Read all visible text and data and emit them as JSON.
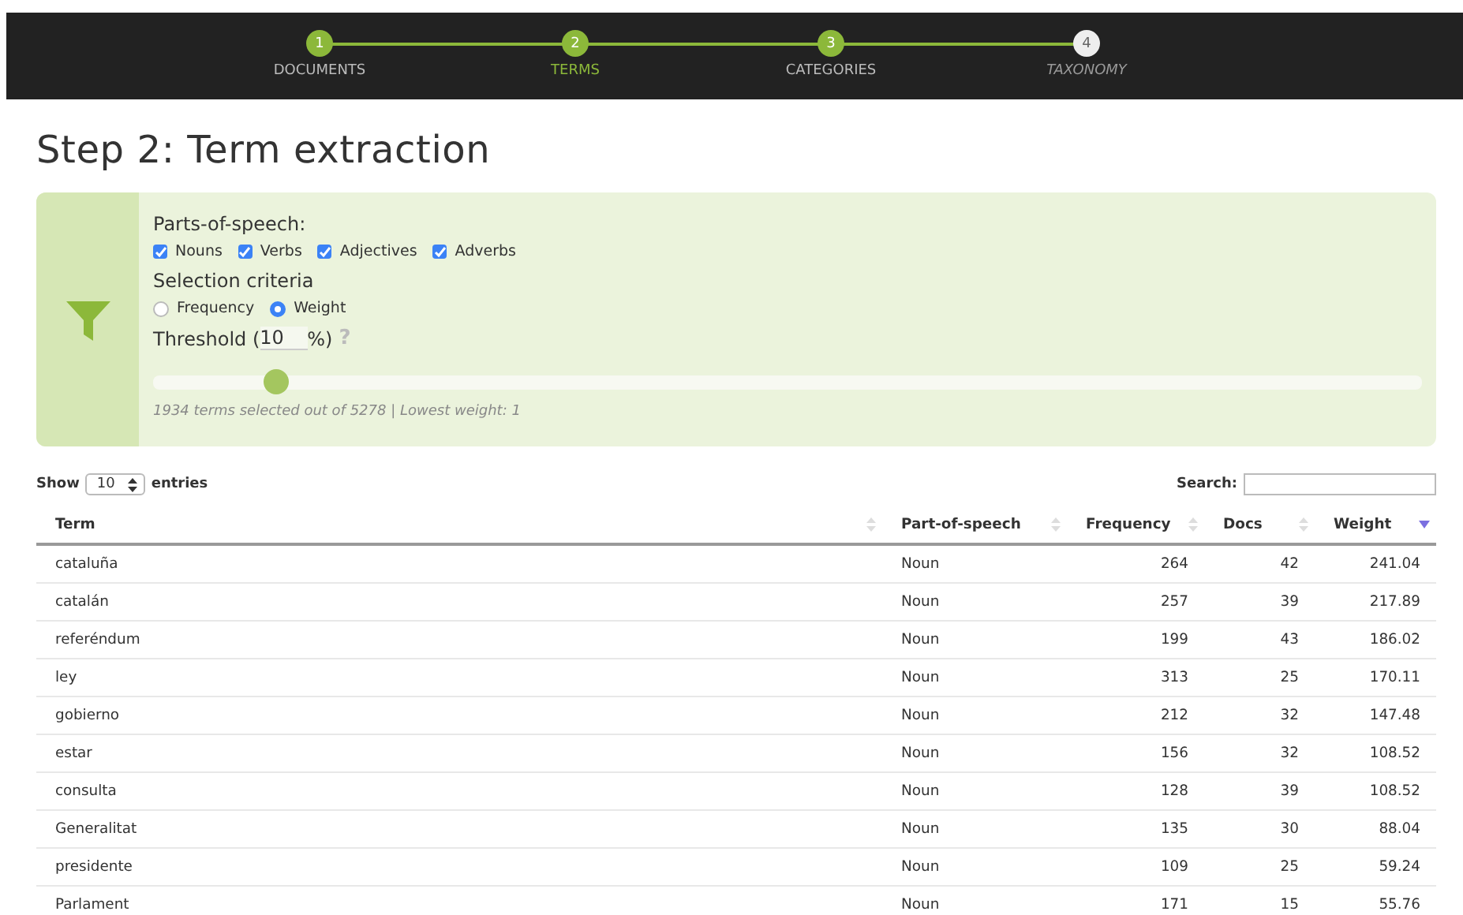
{
  "steps": [
    {
      "number": "1",
      "label": "DOCUMENTS",
      "reached": true,
      "selected": false
    },
    {
      "number": "2",
      "label": "TERMS",
      "reached": true,
      "selected": true
    },
    {
      "number": "3",
      "label": "CATEGORIES",
      "reached": true,
      "selected": false
    },
    {
      "number": "4",
      "label": "TAXONOMY",
      "reached": false,
      "selected": false
    }
  ],
  "title": "Step 2: Term extraction",
  "filter": {
    "pos_heading": "Parts-of-speech:",
    "pos": [
      {
        "label": "Nouns",
        "checked": true
      },
      {
        "label": "Verbs",
        "checked": true
      },
      {
        "label": "Adjectives",
        "checked": true
      },
      {
        "label": "Adverbs",
        "checked": true
      }
    ],
    "criteria_heading": "Selection criteria",
    "criteria": [
      {
        "label": "Frequency",
        "selected": false
      },
      {
        "label": "Weight",
        "selected": true
      }
    ],
    "threshold_label": "Threshold (",
    "threshold_value": "10",
    "threshold_suffix": "%)",
    "help": "?",
    "slider": {
      "level": 0.1
    },
    "summary": "1934 terms selected out of 5278 | Lowest weight: 1"
  },
  "table": {
    "show_label": "Show",
    "page_size": "10",
    "entries_label": "entries",
    "search_label": "Search:",
    "columns": [
      {
        "label": "Term",
        "sorted": false
      },
      {
        "label": "Part-of-speech",
        "sorted": false
      },
      {
        "label": "Frequency",
        "sorted": false
      },
      {
        "label": "Docs",
        "sorted": false
      },
      {
        "label": "Weight",
        "sorted": true
      }
    ],
    "rows": [
      [
        "cataluña",
        "Noun",
        "264",
        "42",
        "241.04"
      ],
      [
        "catalán",
        "Noun",
        "257",
        "39",
        "217.89"
      ],
      [
        "referéndum",
        "Noun",
        "199",
        "43",
        "186.02"
      ],
      [
        "ley",
        "Noun",
        "313",
        "25",
        "170.11"
      ],
      [
        "gobierno",
        "Noun",
        "212",
        "32",
        "147.48"
      ],
      [
        "estar",
        "Noun",
        "156",
        "32",
        "108.52"
      ],
      [
        "consulta",
        "Noun",
        "128",
        "39",
        "108.52"
      ],
      [
        "Generalitat",
        "Noun",
        "135",
        "30",
        "88.04"
      ],
      [
        "presidente",
        "Noun",
        "109",
        "25",
        "59.24"
      ],
      [
        "Parlament",
        "Noun",
        "171",
        "15",
        "55.76"
      ]
    ]
  }
}
